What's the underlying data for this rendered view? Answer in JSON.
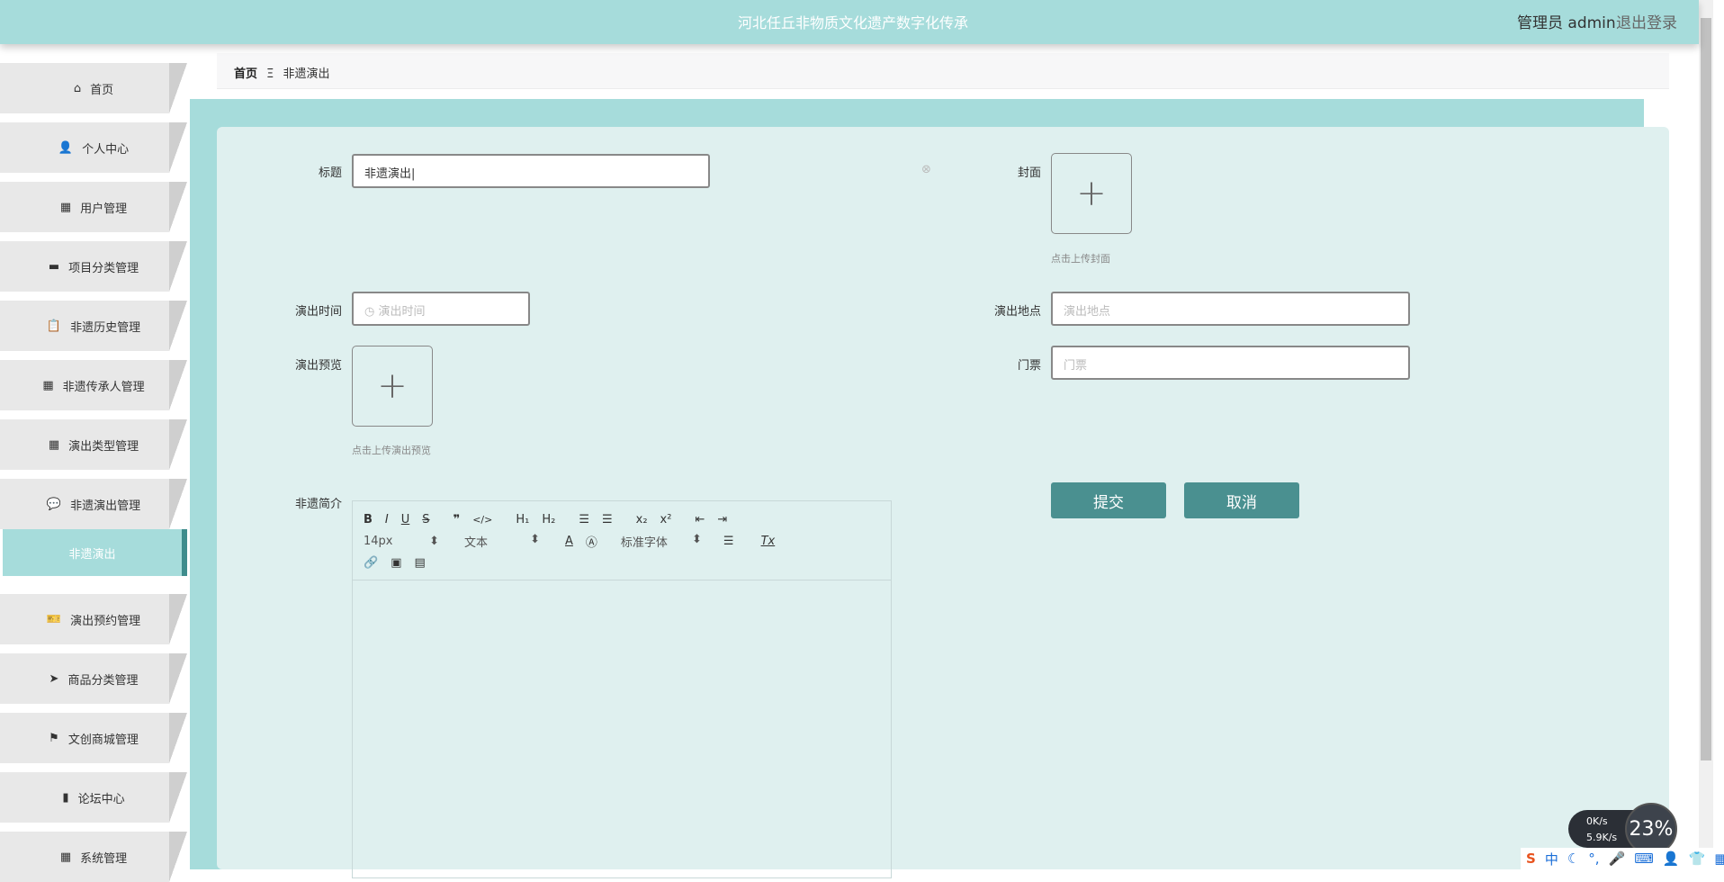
{
  "header": {
    "title": "河北任丘非物质文化遗产数字化传承",
    "user": "管理员 admin",
    "logout": "退出登录"
  },
  "sidebar": {
    "items": [
      {
        "label": "首页",
        "icon": "⌂"
      },
      {
        "label": "个人中心",
        "icon": "👤"
      },
      {
        "label": "用户管理",
        "icon": "▦"
      },
      {
        "label": "项目分类管理",
        "icon": "▬"
      },
      {
        "label": "非遗历史管理",
        "icon": "📋"
      },
      {
        "label": "非遗传承人管理",
        "icon": "▦"
      },
      {
        "label": "演出类型管理",
        "icon": "▦"
      },
      {
        "label": "非遗演出管理",
        "icon": "💬"
      },
      {
        "label": "非遗演出",
        "icon": ""
      },
      {
        "label": "演出预约管理",
        "icon": "🎫"
      },
      {
        "label": "商品分类管理",
        "icon": "➤"
      },
      {
        "label": "文创商城管理",
        "icon": "⚑"
      },
      {
        "label": "论坛中心",
        "icon": "▮"
      },
      {
        "label": "系统管理",
        "icon": "▦"
      }
    ]
  },
  "breadcrumb": {
    "home": "首页",
    "sep": "Ξ",
    "current": "非遗演出"
  },
  "form": {
    "title_label": "标题",
    "title_value": "非遗演出",
    "cover_label": "封面",
    "cover_caption": "点击上传封面",
    "time_label": "演出时间",
    "time_placeholder": "演出时间",
    "place_label": "演出地点",
    "place_placeholder": "演出地点",
    "preview_label": "演出预览",
    "preview_caption": "点击上传演出预览",
    "ticket_label": "门票",
    "ticket_placeholder": "门票",
    "intro_label": "非遗简介",
    "submit": "提交",
    "cancel": "取消"
  },
  "editor": {
    "font_size": "14px",
    "header": "文本",
    "font": "标准字体"
  },
  "tray": {
    "up": "0K/s",
    "down": "5.9K/s",
    "cpu": "23%"
  }
}
